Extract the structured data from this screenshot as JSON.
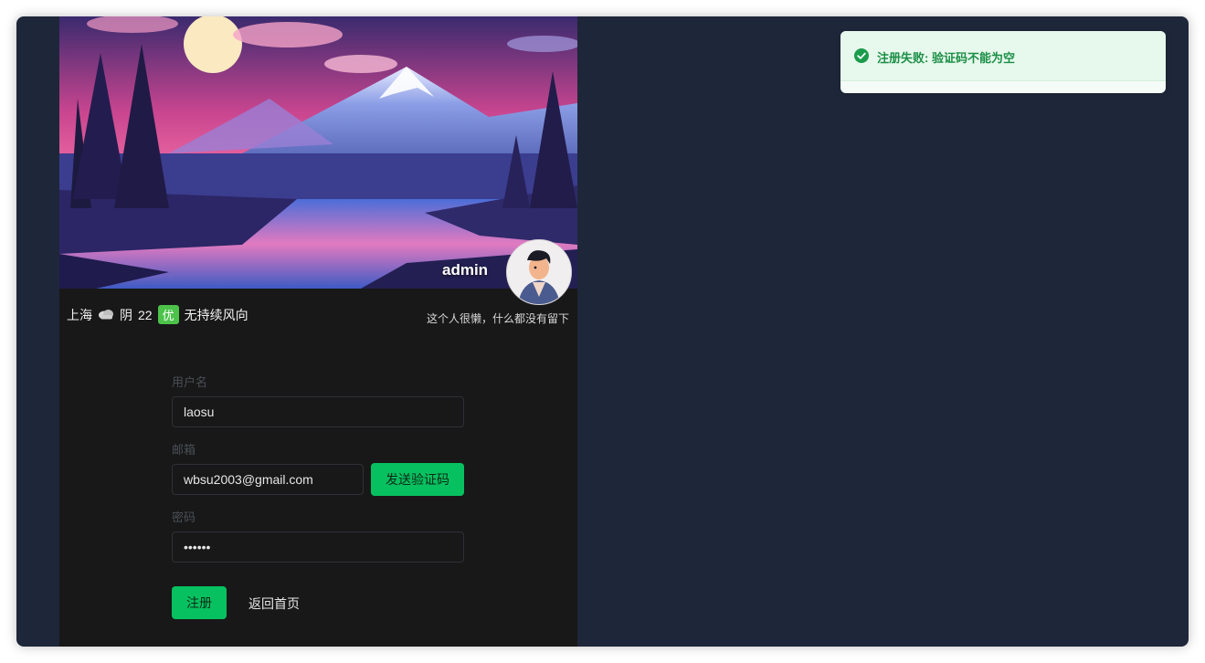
{
  "profile": {
    "username": "admin",
    "bio": "这个人很懒，什么都没有留下"
  },
  "weather": {
    "city": "上海",
    "condition_icon": "cloud-icon",
    "condition": "阴",
    "temperature": "22",
    "aqi": "优",
    "wind": "无持续风向"
  },
  "form": {
    "username_label": "用户名",
    "username_value": "laosu",
    "email_label": "邮箱",
    "email_value": "wbsu2003@gmail.com",
    "send_code_label": "发送验证码",
    "password_label": "密码",
    "password_value": "••••••",
    "register_label": "注册",
    "back_label": "返回首页"
  },
  "toast": {
    "icon": "check-circle-icon",
    "message": "注册失败: 验证码不能为空"
  },
  "colors": {
    "accent": "#07c160",
    "background": "#1e2739",
    "panel": "#181818",
    "toast_text": "#1a8f46"
  }
}
